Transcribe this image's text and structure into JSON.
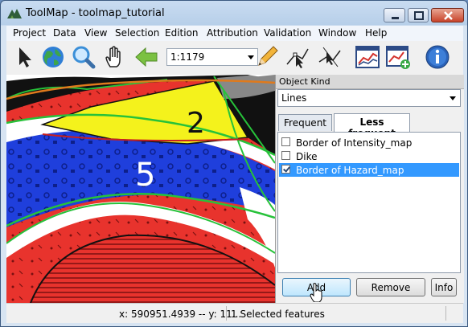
{
  "window": {
    "title": "ToolMap - toolmap_tutorial"
  },
  "menubar": {
    "items": [
      "Project",
      "Data",
      "View",
      "Selection",
      "Edition",
      "Attribution",
      "Validation",
      "Window",
      "Help"
    ]
  },
  "toolbar": {
    "tools": [
      "arrow-select-icon",
      "globe-icon",
      "zoom-magnifier-icon",
      "pan-hand-icon",
      "back-arrow-icon"
    ],
    "scale_value": "1:1179",
    "tools_right": [
      "pencil-icon",
      "edit-vertex-icon",
      "modify-line-icon",
      "chart-profile-icon",
      "chart-add-icon",
      "info-icon"
    ]
  },
  "map": {
    "labels": [
      "2",
      "5"
    ]
  },
  "panel": {
    "header": "Object Kind",
    "kind_selected": "Lines",
    "tabs": [
      {
        "label": "Frequent",
        "active": false
      },
      {
        "label": "Less frequent",
        "active": true
      }
    ],
    "items": [
      {
        "label": "Border of Intensity_map",
        "checked": false,
        "selected": false
      },
      {
        "label": "Dike",
        "checked": false,
        "selected": false
      },
      {
        "label": "Border of Hazard_map",
        "checked": true,
        "selected": true
      }
    ],
    "buttons": {
      "add": "Add",
      "remove": "Remove",
      "info": "Info"
    }
  },
  "statusbar": {
    "coords": "x: 590951.4939 -- y: 11...",
    "selection": "1 Selected features"
  },
  "colors": {
    "selection": "#3399ff",
    "map_red": "#e8332d",
    "map_blue": "#1f3fdc",
    "map_yellow": "#f4f21c",
    "map_green": "#27c23a"
  }
}
